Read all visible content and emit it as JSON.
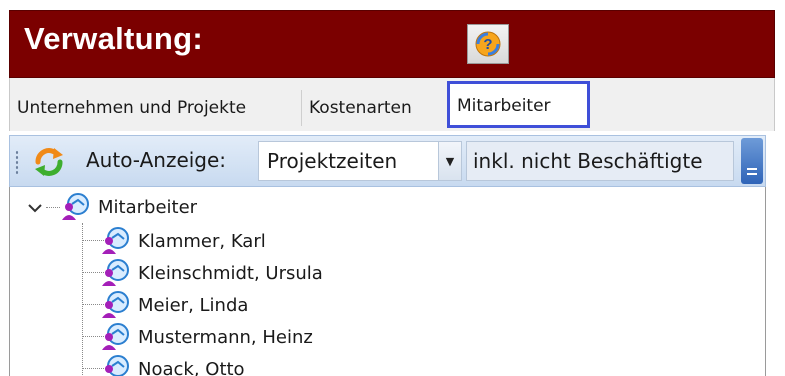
{
  "window": {
    "title": "Verwaltung:"
  },
  "help_button": {
    "icon": "help-icon",
    "symbol": "?"
  },
  "tabs": [
    {
      "label": "Unternehmen und Projekte",
      "selected": false
    },
    {
      "label": "Kostenarten",
      "selected": false
    },
    {
      "label": "Mitarbeiter",
      "selected": true
    }
  ],
  "toolbar": {
    "refresh_icon": "refresh-icon",
    "auto_label": "Auto-Anzeige:",
    "combo_value": "Projektzeiten",
    "combo_arrow": "▼",
    "include_label": "inkl. nicht Beschäftigte"
  },
  "tree": {
    "root": {
      "label": "Mitarbeiter",
      "expanded": true
    },
    "children": [
      {
        "label": "Klammer, Karl"
      },
      {
        "label": "Kleinschmidt, Ursula"
      },
      {
        "label": "Meier, Linda"
      },
      {
        "label": "Mustermann, Heinz"
      },
      {
        "label": "Noack, Otto"
      }
    ]
  },
  "colors": {
    "title_bar": "#7b0000",
    "tab_highlight": "#3f4fd8",
    "toolbar": "#d4e2f4",
    "person_purple": "#a41fb8",
    "person_blue": "#2b7fd0"
  }
}
